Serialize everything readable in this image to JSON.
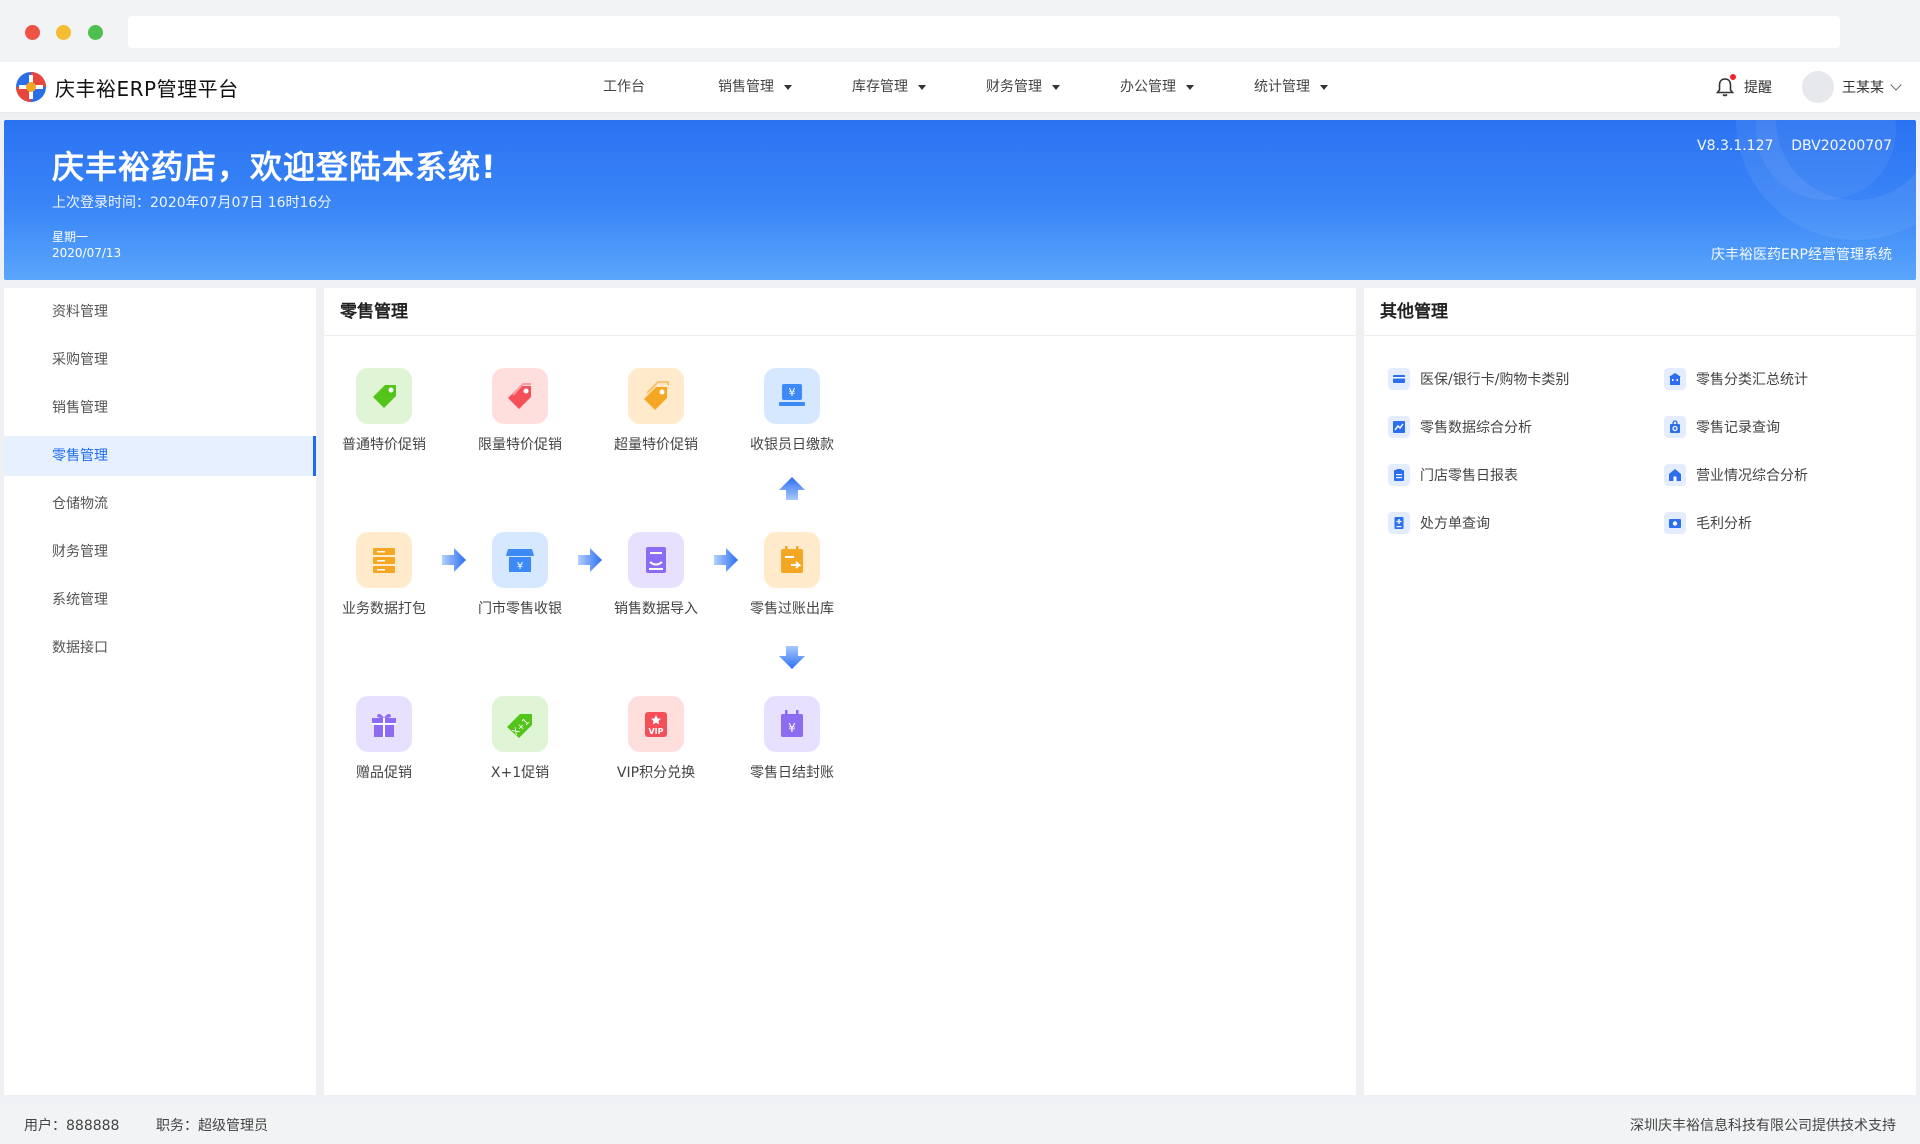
{
  "nav": {
    "app_title": "庆丰裕ERP管理平台",
    "menu": [
      {
        "label": "工作台",
        "dropdown": false
      },
      {
        "label": "销售管理",
        "dropdown": true
      },
      {
        "label": "库存管理",
        "dropdown": true
      },
      {
        "label": "财务管理",
        "dropdown": true
      },
      {
        "label": "办公管理",
        "dropdown": true
      },
      {
        "label": "统计管理",
        "dropdown": true
      }
    ],
    "reminder_label": "提醒",
    "user_name": "王某某"
  },
  "banner": {
    "title": "庆丰裕药店，欢迎登陆本系统!",
    "last_login": "上次登录时间：2020年07月07日 16时16分",
    "weekday": "星期一",
    "date": "2020/07/13",
    "version": "V8.3.1.127    DBV20200707",
    "system_name": "庆丰裕医药ERP经营管理系统"
  },
  "sidebar": {
    "items": [
      {
        "label": "资料管理"
      },
      {
        "label": "采购管理"
      },
      {
        "label": "销售管理"
      },
      {
        "label": "零售管理",
        "active": true
      },
      {
        "label": "仓储物流"
      },
      {
        "label": "财务管理"
      },
      {
        "label": "系统管理"
      },
      {
        "label": "数据接口"
      }
    ]
  },
  "retail": {
    "title": "零售管理",
    "row1": [
      {
        "label": "普通特价促销",
        "icon": "green-tag-icon",
        "color": "#52c41a"
      },
      {
        "label": "限量特价促销",
        "icon": "red-tag-icon",
        "color": "#f5505a"
      },
      {
        "label": "超量特价促销",
        "icon": "orange-tag-icon",
        "color": "#f5a623"
      },
      {
        "label": "收银员日缴款",
        "icon": "cashier-laptop-icon",
        "color": "#3d8af7"
      }
    ],
    "row2": [
      {
        "label": "业务数据打包",
        "icon": "server-stack-icon",
        "color": "#f5a623"
      },
      {
        "label": "门市零售收银",
        "icon": "store-icon",
        "color": "#3d8af7"
      },
      {
        "label": "销售数据导入",
        "icon": "inbox-import-icon",
        "color": "#8c6cf2"
      },
      {
        "label": "零售过账出库",
        "icon": "calendar-export-icon",
        "color": "#f5a623"
      }
    ],
    "row3": [
      {
        "label": "赠品促销",
        "icon": "gift-icon",
        "color": "#8c6cf2"
      },
      {
        "label": "X+1促销",
        "icon": "xplus1-tag-icon",
        "color": "#52c41a"
      },
      {
        "label": "VIP积分兑换",
        "icon": "vip-card-icon",
        "color": "#f5505a"
      },
      {
        "label": "零售日结封账",
        "icon": "calendar-yen-icon",
        "color": "#8c6cf2"
      }
    ]
  },
  "other": {
    "title": "其他管理",
    "items": [
      {
        "label": "医保/银行卡/购物卡类别",
        "icon": "card-icon"
      },
      {
        "label": "零售分类汇总统计",
        "icon": "building-icon"
      },
      {
        "label": "零售数据综合分析",
        "icon": "chart-icon"
      },
      {
        "label": "零售记录查询",
        "icon": "bag-search-icon"
      },
      {
        "label": "门店零售日报表",
        "icon": "clipboard-icon"
      },
      {
        "label": "营业情况综合分析",
        "icon": "house-icon"
      },
      {
        "label": "处方单查询",
        "icon": "document-icon"
      },
      {
        "label": "毛利分析",
        "icon": "wallet-icon"
      }
    ]
  },
  "footer": {
    "user": "用户：888888",
    "role": "职务：超级管理员",
    "support": "深圳庆丰裕信息科技有限公司提供技术支持"
  }
}
